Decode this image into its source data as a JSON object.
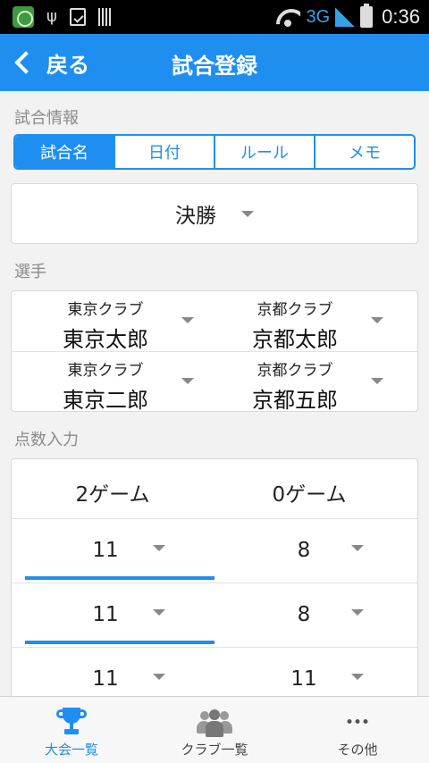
{
  "status_bar": {
    "network": "3G",
    "time": "0:36"
  },
  "app_bar": {
    "back_label": "戻る",
    "title": "試合登録"
  },
  "match_info": {
    "section_label": "試合情報",
    "tabs": [
      {
        "label": "試合名",
        "active": true
      },
      {
        "label": "日付",
        "active": false
      },
      {
        "label": "ルール",
        "active": false
      },
      {
        "label": "メモ",
        "active": false
      }
    ],
    "match_name": "決勝"
  },
  "players": {
    "section_label": "選手",
    "rows": [
      {
        "left": {
          "club": "東京クラブ",
          "name": "東京太郎"
        },
        "right": {
          "club": "京都クラブ",
          "name": "京都太郎"
        }
      },
      {
        "left": {
          "club": "東京クラブ",
          "name": "東京二郎"
        },
        "right": {
          "club": "京都クラブ",
          "name": "京都五郎"
        }
      }
    ]
  },
  "score": {
    "section_label": "点数入力",
    "left_games": "2ゲーム",
    "right_games": "0ゲーム",
    "games": [
      {
        "left": "11",
        "right": "8"
      },
      {
        "left": "11",
        "right": "8"
      },
      {
        "left": "11",
        "right": "11"
      }
    ]
  },
  "bottom_nav": {
    "items": [
      {
        "label": "大会一覧",
        "icon": "trophy-icon",
        "active": true
      },
      {
        "label": "クラブ一覧",
        "icon": "people-icon",
        "active": false
      },
      {
        "label": "その他",
        "icon": "more-icon",
        "active": false
      }
    ]
  },
  "colors": {
    "accent": "#1e8ff0",
    "background": "#f2f2f2"
  }
}
